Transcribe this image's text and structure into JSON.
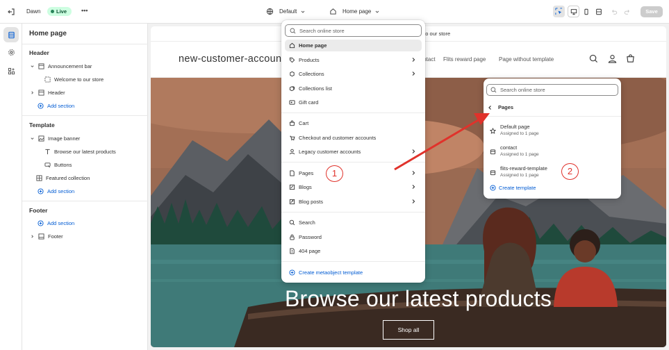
{
  "topbar": {
    "theme_name": "Dawn",
    "theme_status": "Live",
    "more_label": "•••",
    "template_selector": "Default",
    "page_selector": "Home page",
    "save_label": "Save"
  },
  "sidebar": {
    "title": "Home page",
    "header_group": "Header",
    "announcement_bar": "Announcement bar",
    "welcome_block": "Welcome to our store",
    "header_item": "Header",
    "add_section_1": "Add section",
    "template_group": "Template",
    "image_banner": "Image banner",
    "banner_heading": "Browse our latest products",
    "banner_buttons": "Buttons",
    "featured_collection": "Featured collection",
    "add_section_2": "Add section",
    "footer_group": "Footer",
    "add_section_3": "Add section",
    "footer_item": "Footer"
  },
  "preview": {
    "announcement_text": "Welcome to our store",
    "store_name": "new-customer-account-",
    "nav_contact": "Contact",
    "nav_flits": "Flits reward page",
    "nav_no_template": "Page without template",
    "hero_title": "Browse our latest products",
    "hero_button": "Shop all"
  },
  "dropdown": {
    "search_placeholder": "Search online store",
    "items": [
      {
        "label": "Home page",
        "icon": "home-icon"
      },
      {
        "label": "Products",
        "icon": "tag-icon"
      },
      {
        "label": "Collections",
        "icon": "collection-icon"
      },
      {
        "label": "Collections list",
        "icon": "collection-list-icon"
      },
      {
        "label": "Gift card",
        "icon": "gift-card-icon"
      },
      {
        "label": "Cart",
        "icon": "cart-icon"
      },
      {
        "label": "Checkout and customer accounts",
        "icon": "checkout-icon"
      },
      {
        "label": "Legacy customer accounts",
        "icon": "person-icon"
      },
      {
        "label": "Pages",
        "icon": "page-icon"
      },
      {
        "label": "Blogs",
        "icon": "blog-icon"
      },
      {
        "label": "Blog posts",
        "icon": "blog-post-icon"
      },
      {
        "label": "Search",
        "icon": "search-icon"
      },
      {
        "label": "Password",
        "icon": "lock-icon"
      },
      {
        "label": "404 page",
        "icon": "error-page-icon"
      }
    ],
    "create_metaobject": "Create metaobject template"
  },
  "pages_panel": {
    "search_placeholder": "Search online store",
    "back_label": "Pages",
    "templates": [
      {
        "name": "Default page",
        "assigned": "Assigned to 1 page",
        "icon": "star-icon"
      },
      {
        "name": "contact",
        "assigned": "Assigned to 1 page",
        "icon": "template-icon"
      },
      {
        "name": "flits-reward-template",
        "assigned": "Assigned to 1 page",
        "icon": "template-icon"
      }
    ],
    "create_template": "Create template"
  },
  "annotations": {
    "marker_1": "1",
    "marker_2": "2",
    "arrow_color": "#e0322b"
  },
  "colors": {
    "accent": "#005bd3",
    "live_badge_bg": "#cdfee1",
    "annotation": "#e0322b"
  }
}
